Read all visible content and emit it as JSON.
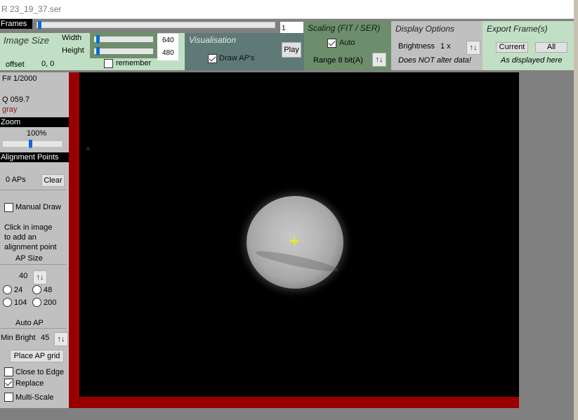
{
  "window": {
    "title": "R 23_19_37.ser"
  },
  "frames": {
    "label": "Frames",
    "current_frame": "1",
    "slider_fraction": 0.0
  },
  "image_size": {
    "title": "Image Size",
    "width_label": "Width",
    "height_label": "Height",
    "width_value": "640",
    "height_value": "480",
    "offset_label": "offset",
    "offset_value": "0, 0",
    "remember_label": "remember",
    "remember_checked": false
  },
  "visualisation": {
    "title": "Visualisation",
    "draw_aps_label": "Draw AP's",
    "draw_aps_checked": true,
    "play_label": "Play"
  },
  "scaling": {
    "title": "Scaling (FIT / SER)",
    "auto_label": "Auto",
    "auto_checked": true,
    "range_label": "Range 8 bit(A)"
  },
  "display_options": {
    "title": "Display Options",
    "brightness_label": "Brightness",
    "brightness_value": "1 x",
    "note": "Does NOT alter data!"
  },
  "export": {
    "title": "Export Frame(s)",
    "current_label": "Current",
    "all_label": "All",
    "note": "As displayed here"
  },
  "sidebar": {
    "frame_info": "F# 1/2000",
    "quality": "Q  059.7",
    "color_mode": "gray",
    "zoom_header": "Zoom",
    "zoom_value": "100%",
    "alignment_header": "Alignment Points",
    "ap_count": "0 APs",
    "clear_label": "Clear",
    "manual_draw_label": "Manual Draw",
    "manual_draw_checked": false,
    "instructions": [
      "Click in image",
      "to add an",
      "alignment point"
    ],
    "ap_size_header": "AP Size",
    "ap_size_value": "40",
    "ap_size_options": [
      "24",
      "48",
      "104",
      "200"
    ],
    "auto_ap_header": "Auto AP",
    "min_bright_label": "Min Bright",
    "min_bright_value": "45",
    "place_grid_label": "Place AP grid",
    "close_to_edge_label": "Close to Edge",
    "close_to_edge_checked": false,
    "replace_label": "Replace",
    "replace_checked": true,
    "multi_scale_label": "Multi-Scale",
    "multi_scale_checked": false
  },
  "icons": {
    "spinner": "↑↓"
  },
  "colors": {
    "viewer_border": "#980000",
    "slider_thumb": "#0a6cd4",
    "ap_marker": "#f0f000"
  }
}
